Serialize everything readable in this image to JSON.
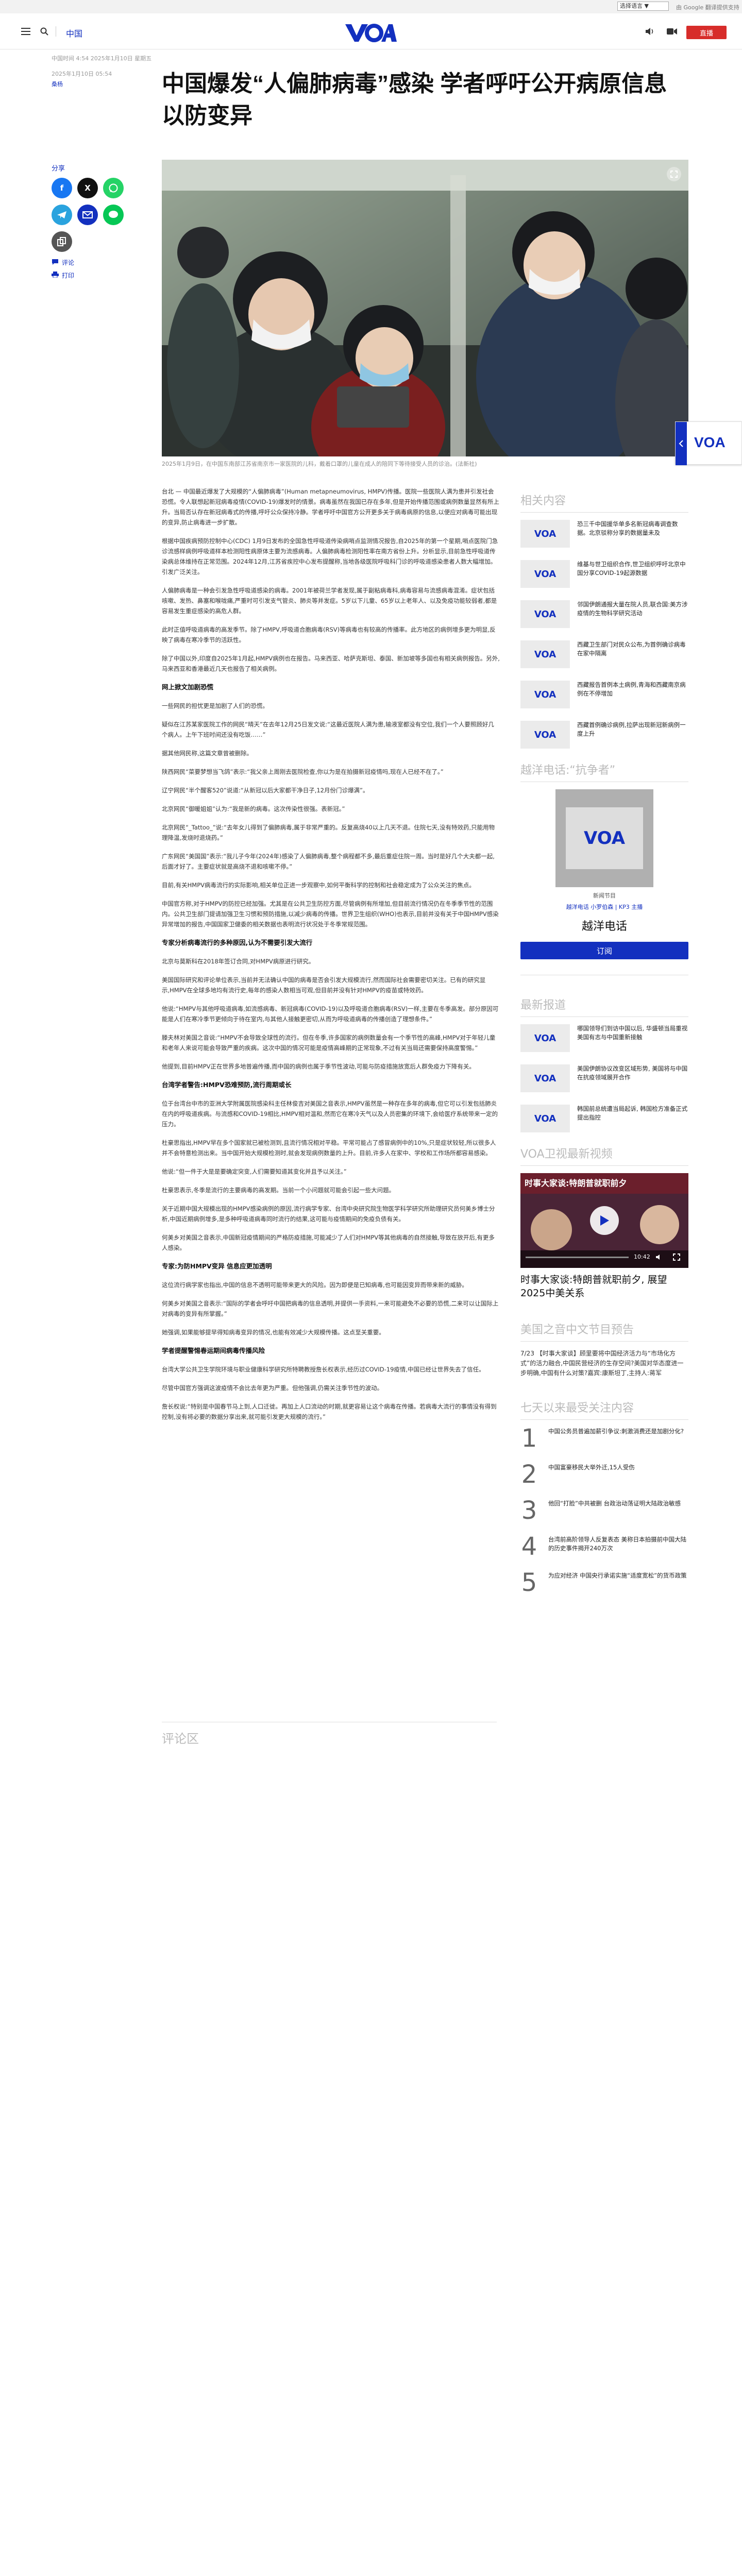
{
  "topbar": {
    "lang_select": "选择语言 ▼",
    "google_credit": "由 Google 翻译提供支持"
  },
  "header": {
    "nav_label": "中国",
    "live_label": "直播"
  },
  "article": {
    "dateline": "中国时间 4:54 2025年1月10日 星期五",
    "date": "2025年1月10日 05:54",
    "author": "桑杨",
    "title": "中国爆发“人偏肺病毒”感染 学者呼吁公开病原信息以防变异",
    "share_label": "分享",
    "comments_link": "评论",
    "print_link": "打印",
    "caption": "2025年1月9日，在中国东南部江苏省南京市一家医院的儿科，戴着口罩的儿童在成人的陪同下等待接受人员的诊治。(法新社)",
    "paragraphs": [
      "台北 — 中国最近爆发了大规模的“人偏肺病毒”(Human metapneumovirus, HMPV)传播。医院一些医院人满为患并引发社会恐慌。令人联想起新冠病毒疫情(COVID-19)爆发时的情景。病毒虽然在我国已存在多年,但是开始传播范围或病例数量显然有所上升。当局否认存在新冠病毒式的传播,呼吁公众保持冷静。学者呼吁中国官方公开更多关于病毒病原的信息,以便应对病毒可能出现的变异,防止病毒进一步扩散。",
      "根据中国疾病预防控制中心(CDC) 1月9日发布的全国急性呼吸道传染病哨点监测情况报告,自2025年的第一个星期,哨点医院门急诊流感样病例呼吸道样本检测阳性病原体主要为流感病毒。人偏肺病毒检测阳性率在南方省份上升。分析显示,目前急性呼吸道传染病总体维持在正常范围。2024年12月,江苏省疾控中心发布提醒称,当地各级医院呼吸科门诊的呼吸道感染患者人数大幅增加。引发广泛关注。",
      "人偏肺病毒是一种会引发急性呼吸道感染的病毒。2001年被荷兰学者发现,属于副粘病毒科,病毒容易与流感病毒混淆。症状包括咳嗽、发热、鼻塞和喉咙痛,严重时可引发支气管炎、肺炎等并发症。5岁以下儿童、65岁以上老年人、以及免疫功能较弱者,都是容易发生重症感染的高危人群。",
      "此时正值呼吸道病毒的高发季节。除了HMPV,呼吸道合胞病毒(RSV)等病毒也有较高的传播率。此方地区的病例增多更为明显,反映了病毒在寒冷季节的活跃性。",
      "除了中国以外,印度自2025年1月起,HMPV病例也在报告。马来西亚、哈萨克斯坦、泰国、新加坡等多国也有相关病例报告。另外,马来西亚和香港最近几天也报告了相关病例。",
      "一些网民的担忧更是加剧了人们的恐慌。",
      "疑似在江苏某家医院工作的网民“晴天”在去年12月25日发文说:“这最近医院人满为患,输液室都没有空位,我们一个人要照顾好几个病人。上午下班时间还没有吃饭……”",
      "据其他网民称,这篇文章曾被删除。",
      "陕西网民“菜要梦想当飞鸽”表示:“我父亲上周刚去医院检查,你以为是在拍摄新冠疫情吗,现在人已经不在了。”",
      "辽宁网民“半个醒客520”说道:“从新冠以后大家都干净日子,12月份门诊爆满”。",
      "北京网民“御暖姐姐”认为:“我是新的病毒。这次传染性很强。表新冠。”",
      "北京网民“_Tattoo_”说:“去年女儿得到了偏肺病毒,属于非常严重的。反复高烧40以上几天不退。住院七天,没有特效药,只能用物理降温,发烧时退烧药。”",
      "广东网民“美国国”表示:“我儿子今年(2024年)感染了人偏肺病毒,整个病程都不多,最后重症住院一周。当时是好几个大夫都一起,后面才好了。主要症状就是高烧不退和咳嗽不停。”",
      "目前,有关HMPV病毒流行的实际影响,相关单位正进一步观察中,如何平衡科学的控制和社会稳定成为了公众关注的焦点。",
      "中国官方称,对于HMPV的防控已经加强。尤其是在公共卫生防控方面,尽管病例有所增加,但目前流行情况仍在冬季季节性的范围内。公共卫生部门提请加强卫生习惯和预防措施,以减少病毒的传播。世界卫生组织(WHO)也表示,目前并没有关于中国HMPV感染异常增加的报告,中国国家卫健委的相关数据也表明流行状况处于冬季常规范围。",
      "北京与莫斯科在2018年签订合同,对HMPV病原进行研究。",
      "美国国际研究和评论单位表示,当前并无法确认中国的病毒是否会引发大规模流行,然而国际社会需要密切关注。已有的研究显示,HMPV在全球多地均有流行史,每年的感染人数相当可观,但目前并没有针对HMPV的疫苗或特效药。",
      "他说:“HMPV与其他呼吸道病毒,如流感病毒、新冠病毒(COVID-19)以及呼吸道合胞病毒(RSV)一样,主要在冬季高发。部分原因可能是人们在寒冷季节更倾向于待在室内,与其他人接触更密切,从而为呼吸道病毒的传播创造了理想条件。”",
      "滕夫林对美国之音说:“HMPV不会导致全球性的流行。但在冬季,许多国家的病例数量会有一个季节性的高峰,HMPV对于年轻儿童和老年人来说可能会导致严重的疾病。这次中国的情况可能是疫情高峰期的正常现象,不过有关当局还需要保持高度警惕。”",
      "他提到,目前HMPV正在世界多地普遍传播,而中国的病例也属于季节性波动,可能与防疫措施放宽后人群免疫力下降有关。",
      "位于台湾台中市的亚洲大学附属医院感染科主任林俊吉对美国之音表示,HMPV虽然是一种存在多年的病毒,但它可以引发包括肺炎在内的呼吸道疾病。与流感和COVID-19相比,HMPV相对温和,然而它在寒冷天气以及人员密集的环境下,会给医疗系统带来一定的压力。",
      "杜豪思指出,HMPV早在多个国家就已被检测到,且流行情况相对平稳。平常可能占了感冒病例中的10%,只是症状较轻,所以很多人并不会特意检测出来。当中国开始大规模检测时,就会发现病例数量的上升。目前,许多人在家中、学校和工作场所都容易感染。",
      "他说:“但一件于大是是要确定突变,人们需要知道其变化并且予以关注。”",
      "杜豪思表示,冬季是流行的主要病毒的高发期。当前一个小问题就可能会引起一些大问题。",
      "关于近期中国大规模出现的HMPV感染病例的原因,流行病学专家、台湾中央研究院生物医学科学研究所助理研究员何美乡博士分析,中国近期病例增多,是多种呼吸道病毒同时流行的结果,这可能与疫情期间的免疫负债有关。",
      "何美乡对美国之音表示,中国新冠疫情期间的严格防疫措施,可能减少了人们对HMPV等其他病毒的自然接触,导致在放开后,有更多人感染。",
      "这位流行病学家也指出,中国的信息不透明可能带来更大的风险。因为即便是已知病毒,也可能因变异而带来新的威胁。",
      "何美乡对美国之音表示:“国际的学者会呼吁中国把病毒的信息透明,并提供一手资料,一来可能避免不必要的恐慌,二来可以让国际上对病毒的变异有所掌握。”",
      "她强调,如果能够提早得知病毒变异的情况,也能有效减少大规模传播。这点至关重要。",
      "台湾大学公共卫生学院环境与职业健康科学研究所特聘教授詹长权表示,经历过COVID-19疫情,中国已经让世界失去了信任。",
      "尽管中国官方强调这波疫情不会比去年更为严重。但他强调,仍需关注季节性的波动。",
      "詹长权说:“特别是中国春节马上到,人口迁徙。再加上人口流动的时期,就更容易让这个病毒在传播。若病毒大流行的事情没有得到控制,没有将必要的数据分享出来,就可能引发更大规模的流行。”"
    ],
    "subheads": [
      "网上掀文加剧恐慌",
      "专家分析病毒流行的多种原因,认为不需要引发大流行",
      "台湾学者警告:HMPV恐难预防,流行周期或长",
      "专家:为防HMPV变异 信息应更加透明",
      "学者提醒警惕春运期间病毒传播风险"
    ],
    "comments_heading": "评论区"
  },
  "rail": {
    "related_heading": "相关内容",
    "related": [
      "恐三千中国援华单多名新冠病毒调查数据。北京驳称分享的数据量未及",
      "维基与世卫组织合作,世卫组织呼吁北京中国分享COVID-19起源数据",
      "邻国伊朗通报大量在院人员,联合国:美方涉疫情的生物科学研究活动",
      "西藏卫生部门对民众公布,为首例确诊病毒在家中隔离",
      "西藏报告首例本土病例,青海和西藏南京病例在不停增加",
      "西藏首例确诊病例,拉萨出现新冠新病例一度上升"
    ],
    "podcast_heading": "越洋电话:“抗争者”",
    "podcast_thumb": "新闻节目",
    "podcast_hosts": "越洋电话 小罗伯森 | KP3 主播",
    "podcast_name": "越洋电话",
    "subscribe": "订阅",
    "latest_heading": "最新报道",
    "latest": [
      "哪国领导们到访中国以后, 华盛顿当局重视美国有志与中国重新接触",
      "美国伊朗协议改变区域形势, 美国将与中国在抗疫领域展开合作",
      "韩国前总统遭当局起诉, 韩国检方准备正式提出指控"
    ],
    "video_heading": "VOA卫视最新视频",
    "video_overlay": "时事大家谈:特朗普就职前夕",
    "video_time": "10:42",
    "video_title": "时事大家谈:特朗普就职前夕, 展望2025中美关系",
    "preview_heading": "美国之音中文节目预告",
    "preview_text": "7/23 【时事大家谈】顾里要将中国经济活力与“市场化方式”的活力融合,中国民营经济的生存空间?美国对华态度进一步明确,中国有什么对策?嘉宾:康斯坦丁,主持人:蒋军",
    "popular_heading": "七天以来最受关注内容",
    "popular": [
      {
        "num": "1",
        "text": "中国公务员普遍加薪引争议:刺激消费还是加剧分化?"
      },
      {
        "num": "2",
        "text": "中国富豪移民大举外迁,15人受伤"
      },
      {
        "num": "3",
        "text": "他回“打脸”中共被删 台政治动荡证明大陆政治敏感"
      },
      {
        "num": "4",
        "text": "台湾前高阶领导人反复表态 美称日本拍摄前中国大陆的历史事件揭开240万次"
      },
      {
        "num": "5",
        "text": "为应对经济 中国央行承诺实施“适度宽松”的货币政策"
      }
    ]
  },
  "colors": {
    "brand": "#1330bf",
    "live": "#d72c2a"
  }
}
